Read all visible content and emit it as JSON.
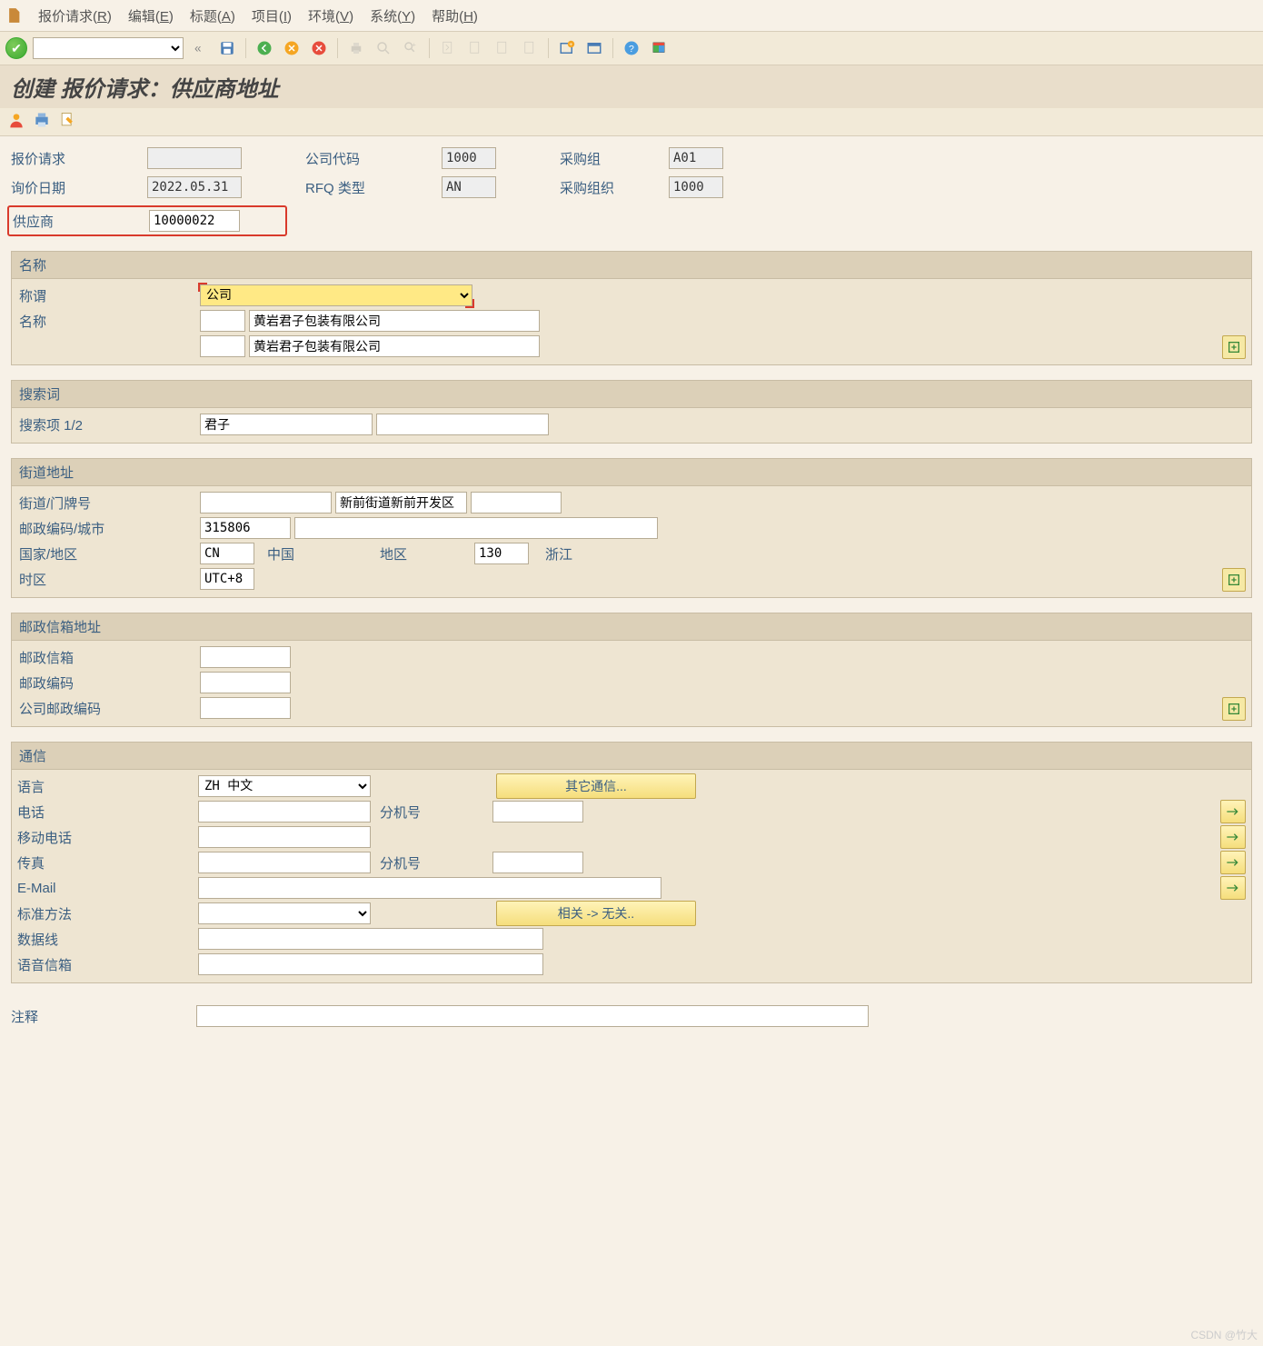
{
  "menu": {
    "rfq": "报价请求(",
    "rfq_u": "R",
    "rfq2": ")",
    "edit": "编辑(",
    "edit_u": "E",
    "title": "标题(",
    "title_u": "A",
    "item": "项目(",
    "item_u": "I",
    "env": "环境(",
    "env_u": "V",
    "sys": "系统(",
    "sys_u": "Y",
    "help": "帮助(",
    "help_u": "H",
    "close": ")"
  },
  "page_title": "创建 报价请求：供应商地址",
  "header": {
    "rfq_label": "报价请求",
    "rfq_value": "",
    "date_label": "询价日期",
    "date_value": "2022.05.31",
    "supplier_label": "供应商",
    "supplier_value": "10000022",
    "cc_label": "公司代码",
    "cc_value": "1000",
    "rfqtype_label": "RFQ 类型",
    "rfqtype_value": "AN",
    "pg_label": "采购组",
    "pg_value": "A01",
    "po_label": "采购组织",
    "po_value": "1000"
  },
  "name_panel": {
    "hdr": "名称",
    "title_lbl": "称谓",
    "title_val": "公司",
    "name_lbl": "名称",
    "name1": "黄岩君子包装有限公司",
    "name2": "黄岩君子包装有限公司"
  },
  "search_panel": {
    "hdr": "搜索词",
    "lbl": "搜索项 1/2",
    "term1": "君子",
    "term2": ""
  },
  "addr_panel": {
    "hdr": "街道地址",
    "street_lbl": "街道/门牌号",
    "street1": "",
    "street2": "新前街道新前开发区",
    "zip_lbl": "邮政编码/城市",
    "zip": "315806",
    "city": "",
    "country_lbl": "国家/地区",
    "country": "CN",
    "country_name": "中国",
    "region_lbl": "地区",
    "region": "130",
    "region_name": "浙江",
    "tz_lbl": "时区",
    "tz": "UTC+8"
  },
  "pobox_panel": {
    "hdr": "邮政信箱地址",
    "po_lbl": "邮政信箱",
    "po_val": "",
    "zip_lbl": "邮政编码",
    "zip_val": "",
    "cc_lbl": "公司邮政编码",
    "cc_val": ""
  },
  "comm_panel": {
    "hdr": "通信",
    "lang_lbl": "语言",
    "lang_val": "ZH 中文",
    "other_btn": "其它通信...",
    "tel_lbl": "电话",
    "ext_lbl": "分机号",
    "mobile_lbl": "移动电话",
    "fax_lbl": "传真",
    "email_lbl": "E-Mail",
    "std_lbl": "标准方法",
    "std_val": "",
    "dep_btn": "相关 -> 无关..",
    "data_lbl": "数据线",
    "voice_lbl": "语音信箱",
    "tel_val": "",
    "tel_ext": "",
    "mobile_val": "",
    "fax_val": "",
    "fax_ext": "",
    "email_val": "",
    "data_val": "",
    "voice_val": ""
  },
  "comment_lbl": "注释",
  "watermark": "CSDN @竹大"
}
